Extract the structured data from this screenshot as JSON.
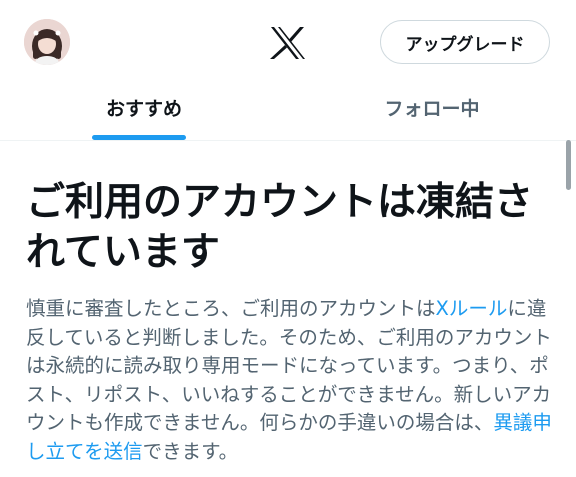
{
  "header": {
    "upgrade_label": "アップグレード"
  },
  "tabs": [
    {
      "label": "おすすめ",
      "active": true
    },
    {
      "label": "フォロー中",
      "active": false
    }
  ],
  "notice": {
    "title": "ご利用のアカウントは凍結されています",
    "body_part1": "慎重に審査したところ、ご利用のアカウントは",
    "rules_link": "Xルール",
    "body_part2": "に違反していると判断しました。そのため、ご利用のアカウントは永続的に読み取り専用モードになっています。つまり、ポスト、リポスト、いいねすることができません。新しいアカウントも作成できません。何らかの手違いの場合は、",
    "appeal_link": "異議申し立てを送信",
    "body_part3": "できます。"
  },
  "colors": {
    "accent": "#1d9bf0",
    "text_primary": "#0f1419",
    "text_secondary": "#536471"
  },
  "icons": [
    "avatar",
    "x-logo-icon"
  ]
}
